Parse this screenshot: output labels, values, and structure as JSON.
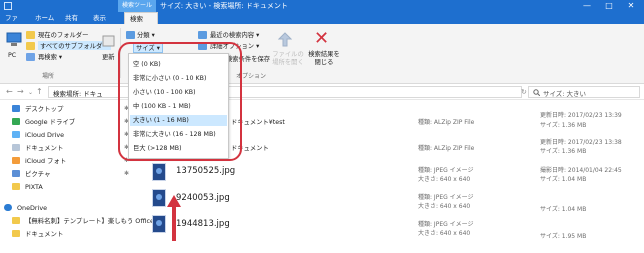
{
  "window": {
    "context_tab": "検索ツール",
    "title": "サイズ: 大きい - 検索場所: ドキュメント"
  },
  "ribbon_tabs": [
    "ファイル",
    "ホーム",
    "共有",
    "表示",
    "検索"
  ],
  "ribbon": {
    "current_folder": "現在のフォルダー",
    "all_subfolders": "すべてのサブフォルダー",
    "search_again": "再検索 ▾",
    "pc": "PC",
    "update": "更新",
    "location_group": "場所",
    "kind": "分類 ▾",
    "size": "サイズ ▾",
    "recent_search": "最近の検索内容 ▾",
    "advanced_options": "詳細オプション ▾",
    "save_search": "検索条件を保存",
    "open_location": "ファイルの場所を開く",
    "options_group": "オプション",
    "close_search": "検索結果を閉じる"
  },
  "address": {
    "path": "検索場所: ドキュ",
    "search_placeholder": "サイズ: 大きい"
  },
  "size_menu": {
    "items": [
      "空 (0 KB)",
      "非常に小さい (0 - 10 KB)",
      "小さい (10 - 100 KB)",
      "中 (100 KB - 1 MB)",
      "大きい (1 - 16 MB)",
      "非常に大きい (16 - 128 MB)",
      "巨大 (>128 MB)"
    ],
    "highlighted_index": 4
  },
  "nav_pane": {
    "items": [
      "デスクトップ",
      "Google ドライブ",
      "iCloud Drive",
      "ドキュメント",
      "iCloud フォト",
      "ピクチャ",
      "PIXTA",
      "OneDrive",
      "【無料名刺】テンプレート】楽しもう Office",
      "ドキュメント"
    ]
  },
  "files": [
    {
      "name": "ドキュメント¥test",
      "type": "種類: ALZip ZIP File",
      "date": "更新日時: 2017/02/23 13:39",
      "size": "サイズ: 1.36 MB"
    },
    {
      "name": "ドキュメント",
      "type": "種類: ALZip ZIP File",
      "date": "更新日時: 2017/02/23 13:38",
      "size": "サイズ: 1.36 MB"
    },
    {
      "name": "13750525.jpg",
      "type": "種類: JPEG イメージ",
      "dims": "大きさ: 640 x 640",
      "date": "撮影日時: 2014/01/04 22:45",
      "size": "サイズ: 1.04 MB"
    },
    {
      "name": "9240053.jpg",
      "type": "種類: JPEG イメージ",
      "dims": "大きさ: 640 x 640",
      "size": "サイズ: 1.04 MB"
    },
    {
      "name": "1944813.jpg",
      "type": "種類: JPEG イメージ",
      "dims": "大きさ: 640 x 640",
      "size": "サイズ: 1.95 MB"
    }
  ],
  "colors": {
    "titlebar": "#1e6fcf",
    "annotation": "#d3333f",
    "highlight": "#cce8ff"
  }
}
